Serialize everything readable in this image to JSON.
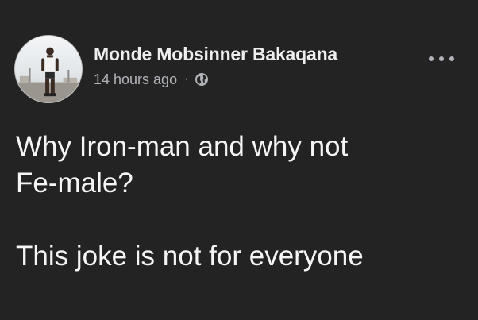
{
  "post": {
    "author": "Monde Mobsinner Bakaqana",
    "timestamp": "14 hours ago",
    "separator": "·",
    "privacy_icon": "globe-icon",
    "more_icon": "more-options-icon",
    "text_lines": [
      "Why Iron-man and why not",
      "Fe-male?",
      "This joke is not for everyone"
    ]
  },
  "colors": {
    "background": "#232323",
    "text": "#f5f5f5",
    "secondary_text": "#b0b3b8"
  }
}
